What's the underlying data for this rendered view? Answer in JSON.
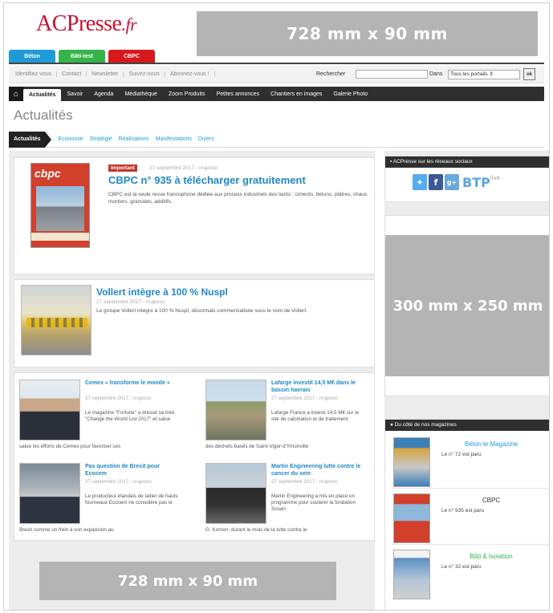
{
  "logo": {
    "brand": "ACPresse",
    "tld": ".fr"
  },
  "banner_top": "728 mm x 90 mm",
  "site_tabs": [
    "Béton",
    "Bâti-test",
    "CBPC"
  ],
  "util_links": [
    "Identifiez-vous",
    "Contact",
    "Newsletter",
    "Suivez-nous",
    "Abonnez-vous !"
  ],
  "search": {
    "label": "Rechercher",
    "value": "",
    "dans_label": "Dans",
    "select_value": "Tous les portails",
    "ok": "ok"
  },
  "main_nav": [
    "Actualités",
    "Savoir",
    "Agenda",
    "Médiathèque",
    "Zoom Produits",
    "Petites annonces",
    "Chantiers en images",
    "Galerie Photo"
  ],
  "page_title": "Actualités",
  "sub_nav": {
    "active": "Actualités",
    "items": [
      "Economie",
      "Stratégie",
      "Réalisations",
      "Manifestations",
      "Divers"
    ]
  },
  "featured": {
    "tag": "Important",
    "meta": "27 septembre 2017 - nraposo",
    "title": "CBPC n° 935 à télécharger gratuitement",
    "desc": "CBPC est la seule revue francophone dédiée aux process industriels des liants : ciments, bétons, plâtres, chaux, mortiers, granulats, additifs."
  },
  "article2": {
    "title": "Vollert intègre à 100 % Nuspl",
    "meta": "27 septembre 2017 - nraposo",
    "desc": "Le groupe Vollert intègre à 100 % Nuspl, désormais commercialisée sous le nom de Vollert."
  },
  "mini_articles": [
    {
      "title": "Cemex « transforme le monde »",
      "meta": "27 septembre 2017 - nraposo",
      "desc": "Le magazine \"Fortune\" a dressé sa liste \"Change the World List 2017\" et salue",
      "overflow": "salue les efforts de Cemex pour favoriser ses"
    },
    {
      "title": "Lafarge investit 14,5 M€ dans le bassin havrais",
      "meta": "27 septembre 2017 - nraposo",
      "desc": "Lafarge France a investi 14,5 M€ sur le site de calcination et de traitement",
      "overflow": "des déchets basés de Saint-Vigor-d'Ymonville"
    },
    {
      "title": "Pas question de Brexit pour Ecocem",
      "meta": "27 septembre 2017 - nraposo",
      "desc": "Le producteur irlandais de laitier de hauts fourneaux Ecocem ne considère pas le",
      "overflow": "Brexit comme un frein à son expansion au"
    },
    {
      "title": "Martin Engineering lutte contre le cancer du sein",
      "meta": "27 septembre 2017 - nraposo",
      "desc": "Martin Engineering a mis en place un programme pour soutenir la fondation Susan",
      "overflow": "G. Komen, durant le mois de la lutte contre le"
    }
  ],
  "banner_bottom": "728 mm x 90 mm",
  "social": {
    "header": "ACPresse sur les réseaux sociaux",
    "btp": "BTP",
    "live": "live"
  },
  "ad_right": "300 mm x 250 mm",
  "magazines": {
    "header": "Du côté de nos magazines",
    "items": [
      {
        "name": "Béton le Magazine",
        "sub": "Le n° 72 est paru",
        "color": "#1e9bd7"
      },
      {
        "name": "CBPC",
        "sub": "Le n° 935 est paru",
        "color": "#333333"
      },
      {
        "name": "Bâti & Isolation",
        "sub": "Le n° 32 est paru",
        "color": "#35b44a"
      }
    ]
  }
}
